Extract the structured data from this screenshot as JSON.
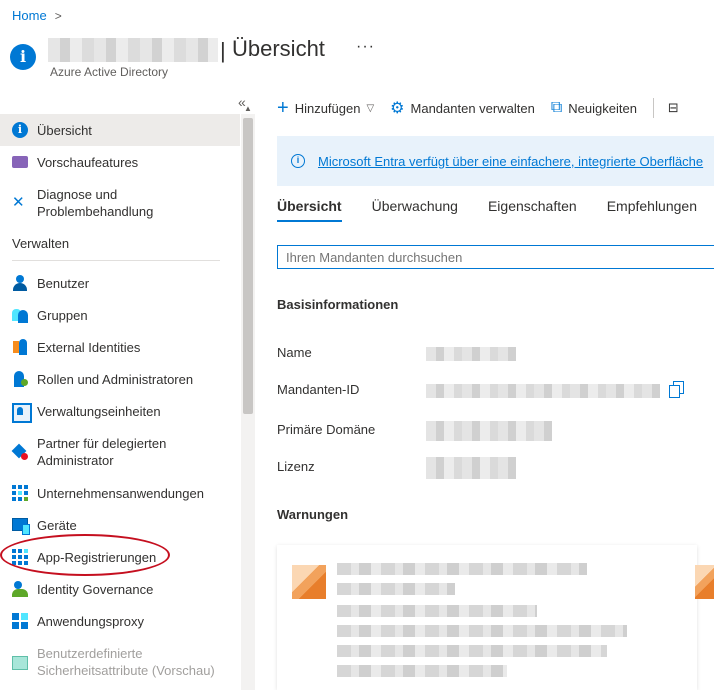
{
  "breadcrumb": {
    "home": "Home",
    "chevron": ">"
  },
  "header": {
    "title": "Übersicht",
    "separator": "|",
    "subtitle": "Azure Active Directory",
    "more": "···"
  },
  "sidebar": {
    "collapse": "«",
    "items_top": [
      {
        "label": "Übersicht",
        "icon": "info-icon",
        "active": true
      },
      {
        "label": "Vorschaufeatures",
        "icon": "preview-icon"
      },
      {
        "label": "Diagnose und Problembehandlung",
        "icon": "diagnose-icon"
      }
    ],
    "section_manage": "Verwalten",
    "items_manage": [
      {
        "label": "Benutzer",
        "icon": "user-icon"
      },
      {
        "label": "Gruppen",
        "icon": "group-icon"
      },
      {
        "label": "External Identities",
        "icon": "external-identities-icon"
      },
      {
        "label": "Rollen und Administratoren",
        "icon": "roles-icon"
      },
      {
        "label": "Verwaltungseinheiten",
        "icon": "admin-units-icon"
      },
      {
        "label": "Partner für delegierten Administrator",
        "icon": "partner-icon"
      },
      {
        "label": "Unternehmensanwendungen",
        "icon": "enterprise-apps-icon"
      },
      {
        "label": "Geräte",
        "icon": "devices-icon"
      },
      {
        "label": "App-Registrierungen",
        "icon": "app-registrations-icon",
        "highlighted": true
      },
      {
        "label": "Identity Governance",
        "icon": "identity-governance-icon"
      },
      {
        "label": "Anwendungsproxy",
        "icon": "app-proxy-icon"
      },
      {
        "label": "Benutzerdefinierte Sicherheitsattribute (Vorschau)",
        "icon": "custom-attributes-icon",
        "disabled": true
      }
    ]
  },
  "toolbar": {
    "add": "Hinzufügen",
    "manage_tenants": "Mandanten verwalten",
    "news": "Neuigkeiten"
  },
  "banner": {
    "text": "Microsoft Entra verfügt über eine einfachere, integrierte Oberfläche"
  },
  "tabs": [
    "Übersicht",
    "Überwachung",
    "Eigenschaften",
    "Empfehlungen"
  ],
  "search": {
    "placeholder": "Ihren Mandanten durchsuchen"
  },
  "basic_info": {
    "heading": "Basisinformationen",
    "labels": {
      "name": "Name",
      "tenant_id": "Mandanten-ID",
      "primary_domain": "Primäre Domäne",
      "license": "Lizenz"
    }
  },
  "warnings": {
    "heading": "Warnungen"
  },
  "colors": {
    "accent": "#0078d4",
    "highlight": "#c50f1f",
    "banner_bg": "#e8f2fb"
  }
}
